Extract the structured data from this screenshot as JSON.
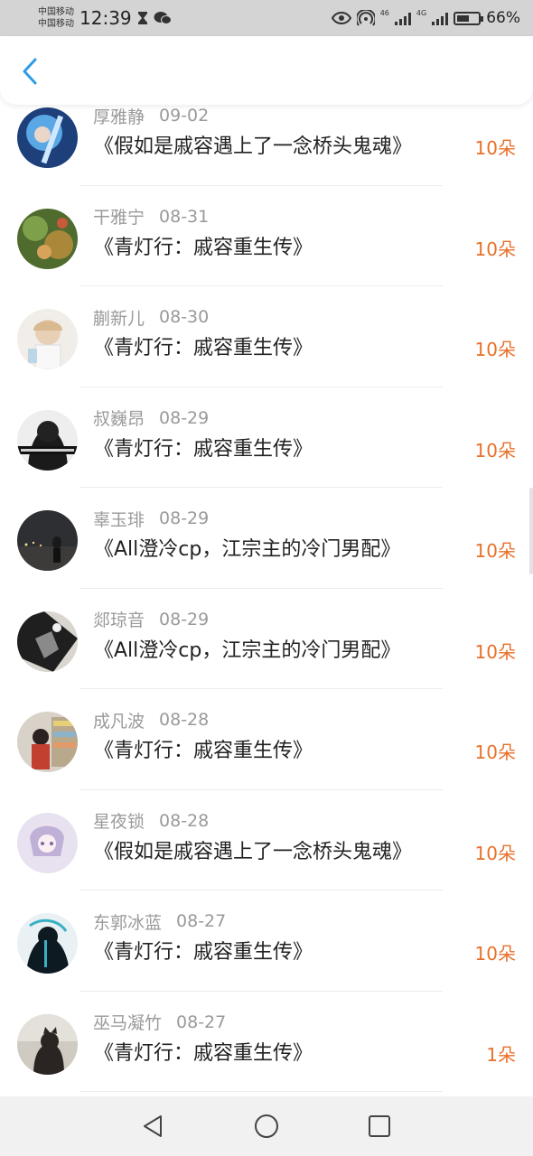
{
  "status_bar": {
    "carrier_1": "中国移动",
    "carrier_2": "中国移动",
    "time": "12:39",
    "sim1_label": "46",
    "sim2_label": "4G",
    "battery_percent": "66%",
    "battery_level": 0.66,
    "icons": [
      "hourglass-icon",
      "wechat-icon",
      "eye-icon",
      "hotspot-icon",
      "signal-icon",
      "battery-icon"
    ]
  },
  "header": {
    "back_icon": "chevron-left-icon",
    "accent_color": "#2f9be8"
  },
  "gifts": [
    {
      "name": "厚雅静",
      "date": "09-02",
      "title": "《假如是戚容遇上了一念桥头鬼魂》",
      "count": "10朵",
      "avatar": "blue-anime"
    },
    {
      "name": "干雅宁",
      "date": "08-31",
      "title": "《青灯行：戚容重生传》",
      "count": "10朵",
      "avatar": "green-nature"
    },
    {
      "name": "蒯新儿",
      "date": "08-30",
      "title": "《青灯行：戚容重生传》",
      "count": "10朵",
      "avatar": "light-anime"
    },
    {
      "name": "叔巍昂",
      "date": "08-29",
      "title": "《青灯行：戚容重生传》",
      "count": "10朵",
      "avatar": "dark-hood"
    },
    {
      "name": "辜玉琲",
      "date": "08-29",
      "title": "《All澄冷cp，江宗主的冷门男配》",
      "count": "10朵",
      "avatar": "night-city"
    },
    {
      "name": "郯琼音",
      "date": "08-29",
      "title": "《All澄冷cp，江宗主的冷门男配》",
      "count": "10朵",
      "avatar": "gray-art"
    },
    {
      "name": "成凡波",
      "date": "08-28",
      "title": "《青灯行：戚容重生传》",
      "count": "10朵",
      "avatar": "shop-girl"
    },
    {
      "name": "星夜锁",
      "date": "08-28",
      "title": "《假如是戚容遇上了一念桥头鬼魂》",
      "count": "10朵",
      "avatar": "lilac-anime"
    },
    {
      "name": "东郭冰蓝",
      "date": "08-27",
      "title": "《青灯行：戚容重生传》",
      "count": "10朵",
      "avatar": "reaper"
    },
    {
      "name": "巫马凝竹",
      "date": "08-27",
      "title": "《青灯行：戚容重生传》",
      "count": "1朵",
      "avatar": "dark-cat"
    }
  ],
  "colors": {
    "flower_count": "#e8702a",
    "name_date": "#9a9a9a",
    "title": "#222222"
  },
  "nav": {
    "back_icon": "triangle-back-icon",
    "home_icon": "circle-home-icon",
    "recents_icon": "square-recents-icon"
  }
}
